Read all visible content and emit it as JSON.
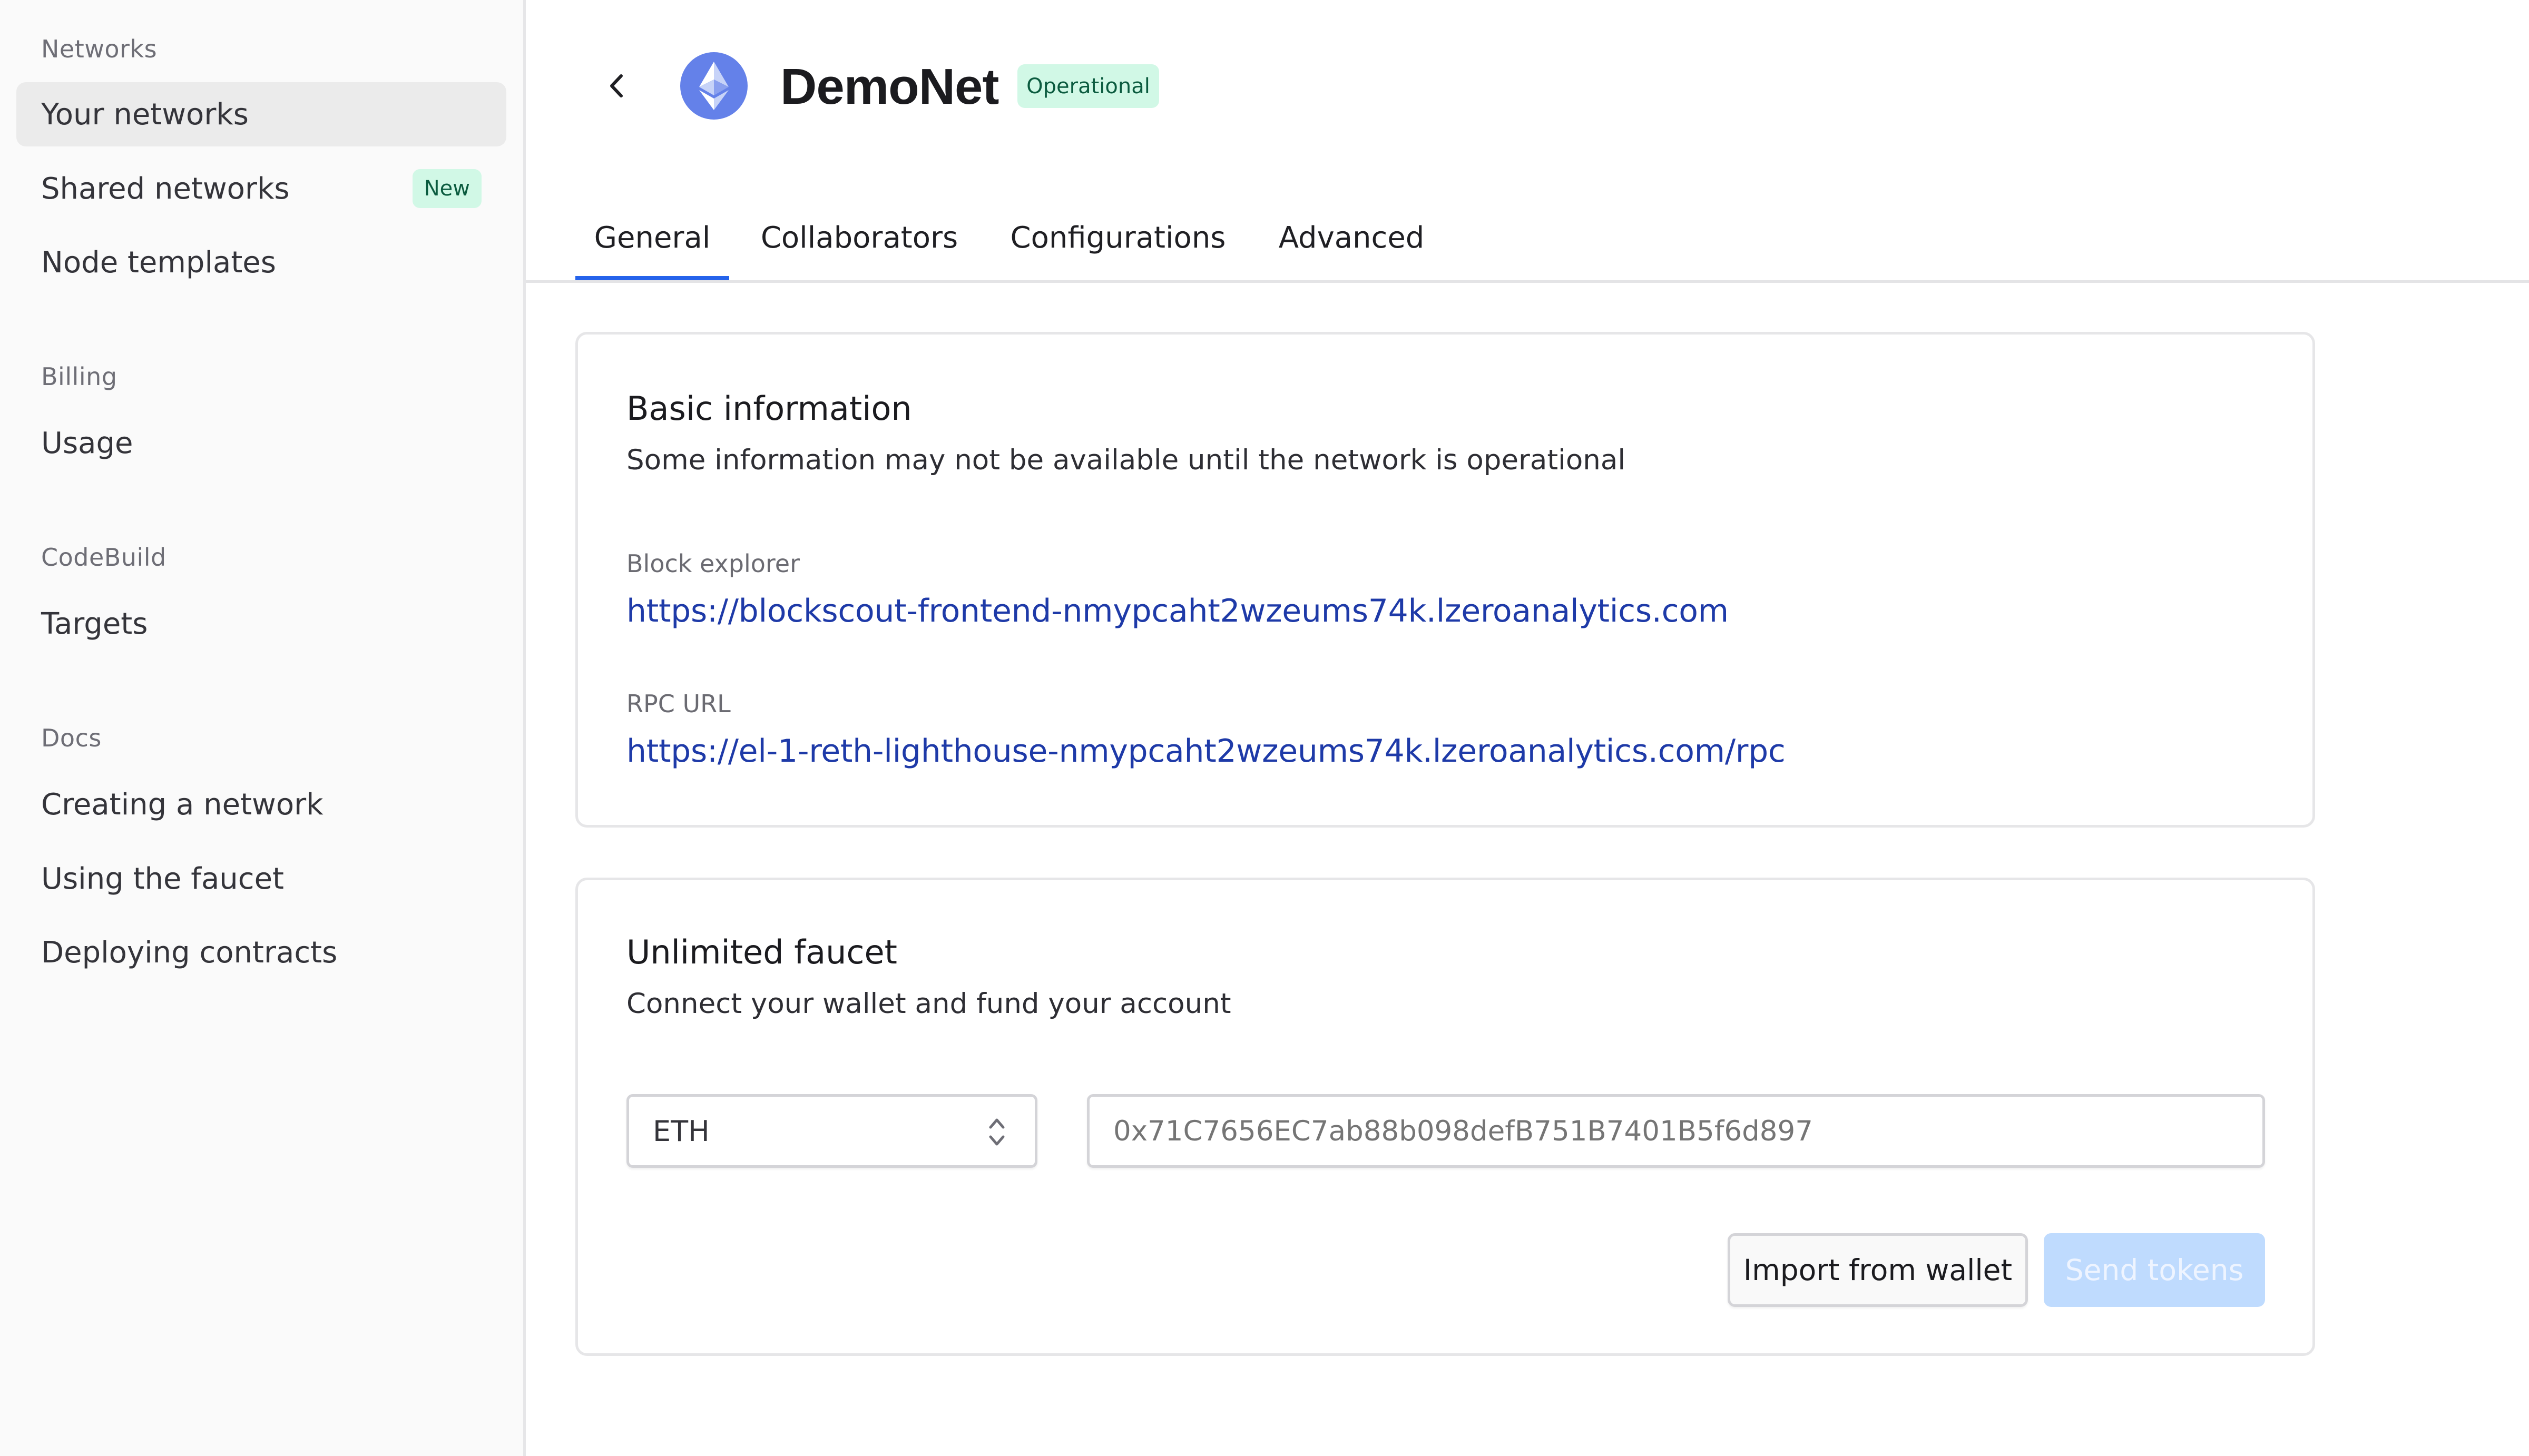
{
  "sidebar": {
    "sections": [
      {
        "heading": "Networks",
        "items": [
          {
            "label": "Your networks",
            "active": true
          },
          {
            "label": "Shared networks",
            "badge": "New"
          },
          {
            "label": "Node templates"
          }
        ]
      },
      {
        "heading": "Billing",
        "items": [
          {
            "label": "Usage"
          }
        ]
      },
      {
        "heading": "CodeBuild",
        "items": [
          {
            "label": "Targets"
          }
        ]
      },
      {
        "heading": "Docs",
        "items": [
          {
            "label": "Creating a network"
          },
          {
            "label": "Using the faucet"
          },
          {
            "label": "Deploying contracts"
          }
        ]
      }
    ]
  },
  "header": {
    "back_icon": "chevron-left-icon",
    "network_icon": "ethereum-icon",
    "title": "DemoNet",
    "status": "Operational"
  },
  "tabs": [
    {
      "label": "General",
      "active": true
    },
    {
      "label": "Collaborators"
    },
    {
      "label": "Configurations"
    },
    {
      "label": "Advanced"
    }
  ],
  "basic_info": {
    "title": "Basic information",
    "subtitle": "Some information may not be available until the network is operational",
    "block_explorer_label": "Block explorer",
    "block_explorer_url": "https://blockscout-frontend-nmypcaht2wzeums74k.lzeroanalytics.com",
    "rpc_label": "RPC URL",
    "rpc_url": "https://el-1-reth-lighthouse-nmypcaht2wzeums74k.lzeroanalytics.com/rpc"
  },
  "faucet": {
    "title": "Unlimited faucet",
    "subtitle": "Connect your wallet and fund your account",
    "token_selected": "ETH",
    "address_placeholder": "0x71C7656EC7ab88b098defB751B7401B5f6d897",
    "address_value": "",
    "import_button": "Import from wallet",
    "send_button": "Send tokens",
    "send_disabled": true
  },
  "colors": {
    "accent": "#2563eb",
    "link": "#1e3aa8",
    "badge_bg": "#d1f8e6",
    "badge_text": "#0b5b3f",
    "eth_icon": "#6481e9",
    "send_disabled_bg": "#bfdbfe"
  }
}
